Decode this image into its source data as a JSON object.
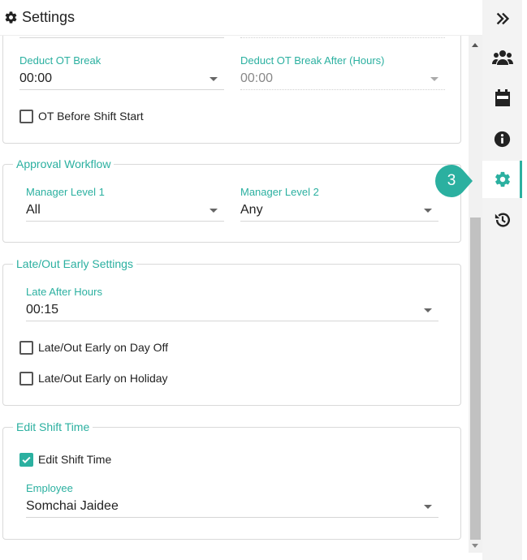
{
  "header": {
    "title": "Settings",
    "icon": "gear-icon"
  },
  "ot_section": {
    "fields": [
      {
        "label": "Deduct OT Break",
        "value": "00:00"
      },
      {
        "label": "Deduct OT Break After (Hours)",
        "value": "00:00"
      }
    ],
    "checkbox": {
      "label": "OT Before Shift Start",
      "checked": false
    }
  },
  "approval": {
    "legend": "Approval Workflow",
    "fields": [
      {
        "label": "Manager Level 1",
        "value": "All"
      },
      {
        "label": "Manager Level 2",
        "value": "Any"
      }
    ]
  },
  "late": {
    "legend": "Late/Out Early Settings",
    "field": {
      "label": "Late After Hours",
      "value": "00:15"
    },
    "checkboxes": [
      {
        "label": "Late/Out Early on Day Off",
        "checked": false
      },
      {
        "label": "Late/Out Early on Holiday",
        "checked": false
      }
    ]
  },
  "edit_shift": {
    "legend": "Edit Shift Time",
    "checkbox": {
      "label": "Edit Shift Time",
      "checked": true
    },
    "field": {
      "label": "Employee",
      "value": "Somchai Jaidee"
    }
  },
  "rail": {
    "items": [
      "expand-icon",
      "team-icon",
      "calendar-icon",
      "info-icon",
      "settings-icon",
      "history-icon"
    ],
    "active": "settings-icon"
  },
  "callout": {
    "number": "3"
  },
  "colors": {
    "accent": "#2bb0a0",
    "rail_bg": "#f3f3f3"
  }
}
